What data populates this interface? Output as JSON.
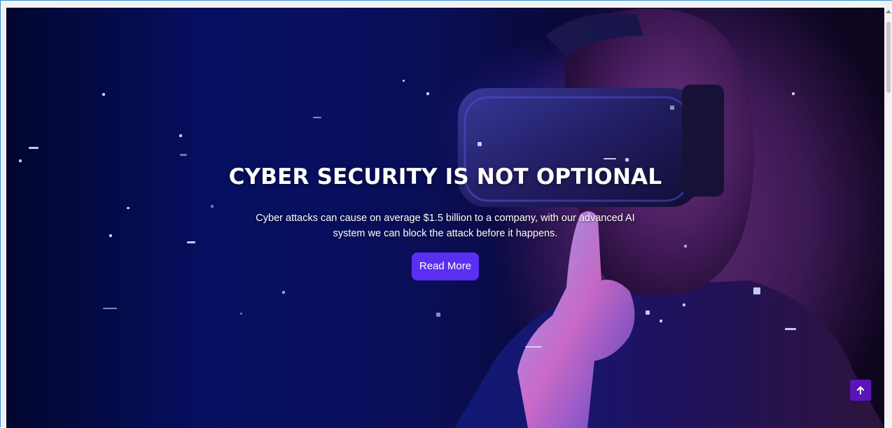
{
  "hero": {
    "title": "CYBER SECURITY IS NOT OPTIONAL",
    "description": "Cyber attacks can cause on average $1.5 billion to a company, with our advanced AI system we can block the attack before it happens.",
    "cta_label": "Read More",
    "background_image": "vr-headset-person-shush"
  },
  "back_to_top": {
    "icon": "arrow-up-icon"
  },
  "colors": {
    "accent": "#5a2ff2",
    "back_to_top": "#5a14b8",
    "hero_dark": "#061066",
    "hero_purple": "#4a1f67"
  }
}
